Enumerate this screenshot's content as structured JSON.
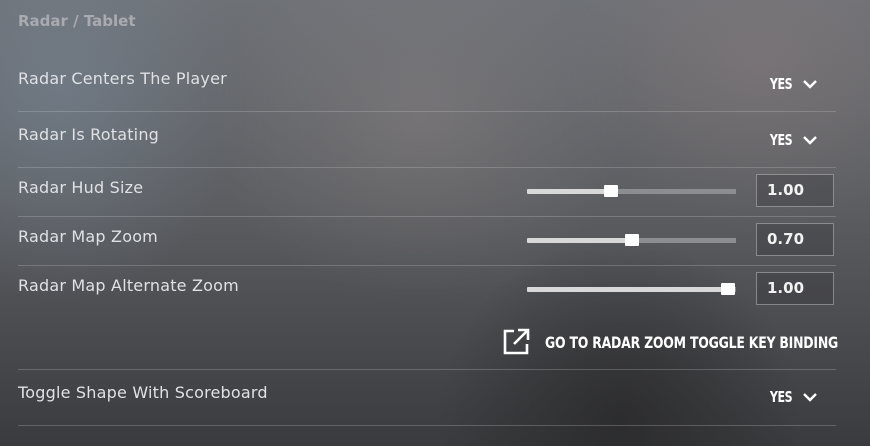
{
  "section": {
    "title": "Radar / Tablet"
  },
  "settings": {
    "radar_centers": {
      "label": "Radar Centers The Player",
      "value": "YES"
    },
    "radar_rotating": {
      "label": "Radar Is Rotating",
      "value": "YES"
    },
    "radar_hud_size": {
      "label": "Radar Hud Size",
      "value": "1.00",
      "fill_percent": 40
    },
    "radar_map_zoom": {
      "label": "Radar Map Zoom",
      "value": "0.70",
      "fill_percent": 50
    },
    "radar_alt_zoom": {
      "label": "Radar Map Alternate Zoom",
      "value": "1.00",
      "fill_percent": 96
    },
    "toggle_shape": {
      "label": "Toggle Shape With Scoreboard",
      "value": "YES"
    }
  },
  "zoom_link": {
    "label": "GO TO RADAR ZOOM TOGGLE KEY BINDING",
    "icon": "external-link-icon"
  },
  "icons": {
    "dropdown": "chevron-down-icon"
  },
  "colors": {
    "text": "#dfe1e4",
    "accent": "#ffffff",
    "track_fill": "#d8d8d8",
    "track_empty": "#8c8d90"
  }
}
